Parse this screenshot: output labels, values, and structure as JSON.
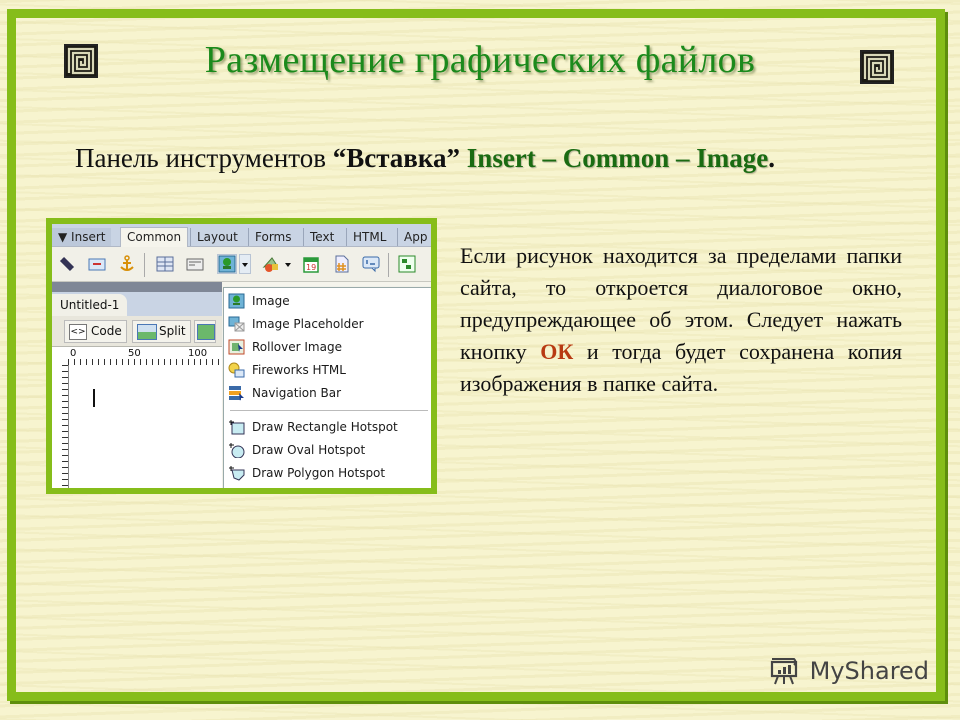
{
  "slide": {
    "title": "Размещение графических файлов",
    "subtitle": {
      "prefix": "Панель инструментов ",
      "quoted": "“Вставка”",
      "path_insert": "Insert",
      "dash1": " – ",
      "path_common": "Common",
      "dash2": " – ",
      "path_image": "Image",
      "end": "."
    },
    "paragraph": {
      "before": "Если рисунок находится за пределами папки сайта, то откроется диалоговое окно, предупреждающее об этом. Следует нажать кнопку ",
      "ok": "ОК",
      "after": " и тогда будет сохранена копия изображения в папке сайта."
    },
    "colors": {
      "frame": "#86bd1a",
      "title": "#1b8a1c",
      "highlight": "#1a6b12",
      "ok": "#b83a12"
    },
    "watermark": "MyShared"
  },
  "screenshot": {
    "panel_label": "▼ Insert",
    "tabs": [
      "Common",
      "Layout",
      "Forms",
      "Text",
      "HTML",
      "App"
    ],
    "active_tab": "Common",
    "toolbar_icons": [
      "hyperlink-icon",
      "email-link-icon",
      "named-anchor-icon",
      "table-icon",
      "insert-div-icon",
      "image-icon",
      "dropdown-arrow",
      "media-icon",
      "dropdown-arrow",
      "date-icon",
      "server-side-include-icon",
      "comment-icon",
      "template-icon"
    ],
    "document_tab": "Untitled-1",
    "view_buttons": [
      "Code",
      "Split"
    ],
    "ruler_ticks": [
      "0",
      "50",
      "100"
    ],
    "menu": {
      "items": [
        {
          "label": "Image",
          "icon": "image-icon"
        },
        {
          "label": "Image Placeholder",
          "icon": "image-placeholder-icon"
        },
        {
          "label": "Rollover Image",
          "icon": "rollover-image-icon"
        },
        {
          "label": "Fireworks HTML",
          "icon": "fireworks-html-icon"
        },
        {
          "label": "Navigation Bar",
          "icon": "navigation-bar-icon"
        }
      ],
      "hotspots": [
        {
          "label": "Draw Rectangle Hotspot",
          "icon": "rectangle-hotspot-icon"
        },
        {
          "label": "Draw Oval Hotspot",
          "icon": "oval-hotspot-icon"
        },
        {
          "label": "Draw Polygon Hotspot",
          "icon": "polygon-hotspot-icon"
        }
      ]
    }
  }
}
